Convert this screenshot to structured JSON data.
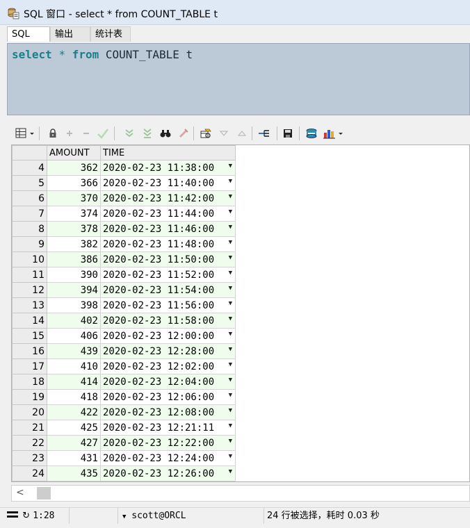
{
  "window": {
    "title": "SQL 窗口 - select * from COUNT_TABLE t"
  },
  "tabs": [
    {
      "label": "SQL"
    },
    {
      "label": "输出"
    },
    {
      "label": "统计表"
    }
  ],
  "editor": {
    "kw_select": "select",
    "star": "*",
    "kw_from": "from",
    "table_ref": "COUNT_TABLE t"
  },
  "grid": {
    "columns": [
      "AMOUNT",
      "TIME"
    ],
    "rows": [
      {
        "n": "4",
        "amount": "362",
        "time": "2020-02-23 11:38:00"
      },
      {
        "n": "5",
        "amount": "366",
        "time": "2020-02-23 11:40:00"
      },
      {
        "n": "6",
        "amount": "370",
        "time": "2020-02-23 11:42:00"
      },
      {
        "n": "7",
        "amount": "374",
        "time": "2020-02-23 11:44:00"
      },
      {
        "n": "8",
        "amount": "378",
        "time": "2020-02-23 11:46:00"
      },
      {
        "n": "9",
        "amount": "382",
        "time": "2020-02-23 11:48:00"
      },
      {
        "n": "10",
        "amount": "386",
        "time": "2020-02-23 11:50:00"
      },
      {
        "n": "11",
        "amount": "390",
        "time": "2020-02-23 11:52:00"
      },
      {
        "n": "12",
        "amount": "394",
        "time": "2020-02-23 11:54:00"
      },
      {
        "n": "13",
        "amount": "398",
        "time": "2020-02-23 11:56:00"
      },
      {
        "n": "14",
        "amount": "402",
        "time": "2020-02-23 11:58:00"
      },
      {
        "n": "15",
        "amount": "406",
        "time": "2020-02-23 12:00:00"
      },
      {
        "n": "16",
        "amount": "439",
        "time": "2020-02-23 12:28:00"
      },
      {
        "n": "17",
        "amount": "410",
        "time": "2020-02-23 12:02:00"
      },
      {
        "n": "18",
        "amount": "414",
        "time": "2020-02-23 12:04:00"
      },
      {
        "n": "19",
        "amount": "418",
        "time": "2020-02-23 12:06:00"
      },
      {
        "n": "20",
        "amount": "422",
        "time": "2020-02-23 12:08:00"
      },
      {
        "n": "21",
        "amount": "425",
        "time": "2020-02-23 12:21:11"
      },
      {
        "n": "22",
        "amount": "427",
        "time": "2020-02-23 12:22:00"
      },
      {
        "n": "23",
        "amount": "431",
        "time": "2020-02-23 12:24:00"
      },
      {
        "n": "24",
        "amount": "435",
        "time": "2020-02-23 12:26:00"
      }
    ]
  },
  "status": {
    "cursor": "1:28",
    "connection": "scott@ORCL",
    "message": "24 行被选择，耗时 0.03 秒"
  },
  "icons": {
    "toolbar": [
      "grid-layout-icon",
      "lock-icon",
      "add-record-icon",
      "delete-record-icon",
      "post-changes-icon",
      "next-page-icon",
      "last-page-icon",
      "find-icon",
      "clear-icon",
      "query-by-example-icon",
      "sort-descending-icon",
      "sort-ascending-icon",
      "link-icon",
      "save-icon",
      "export-icon",
      "chart-icon"
    ]
  },
  "colors": {
    "keyword": "#1a7f8a",
    "editor_bg": "#bccad8",
    "row_alt": "#eefdec"
  }
}
